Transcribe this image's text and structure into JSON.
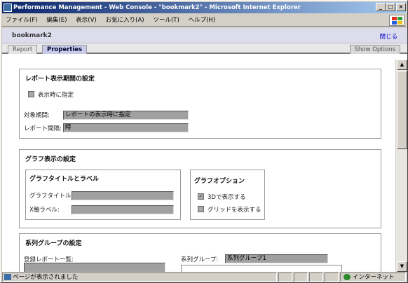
{
  "window": {
    "title": "Performance Management - Web Console - \"bookmark2\" - Microsoft Internet Explorer",
    "min": "_",
    "max": "□",
    "close": "×"
  },
  "menu": [
    "ファイル(F)",
    "編集(E)",
    "表示(V)",
    "お気に入り(A)",
    "ツール(T)",
    "ヘルプ(H)"
  ],
  "header": {
    "title": "bookmark2",
    "close_link": "閉じる"
  },
  "tabs": {
    "report": "Report",
    "properties": "Properties",
    "show_options": "Show Options"
  },
  "period": {
    "title": "レポート表示期間の設定",
    "checkbox_label": "表示時に指定",
    "checked": false,
    "target_label": "対象期間:",
    "target_value": "レポートの表示時に指定",
    "interval_label": "レポート間隔:",
    "interval_value": "時"
  },
  "graph": {
    "title": "グラフ表示の設定",
    "labels_group": {
      "title": "グラフタイトルとラベル",
      "graph_title_label": "グラフタイトル:",
      "graph_title_value": "",
      "xaxis_label": "X軸ラベル:",
      "xaxis_value": ""
    },
    "options_group": {
      "title": "グラフオプション",
      "opt3d": "3Dで表示する",
      "opt3d_checked": true,
      "grid": "グリッドを表示する",
      "grid_checked": false
    }
  },
  "series": {
    "title": "系列グループの設定",
    "reports_label": "登録レポート一覧:",
    "group_label": "系列グループ:",
    "group_value": "系列グループ1"
  },
  "status": {
    "text": "ページが表示されました",
    "zone": "インターネット"
  }
}
